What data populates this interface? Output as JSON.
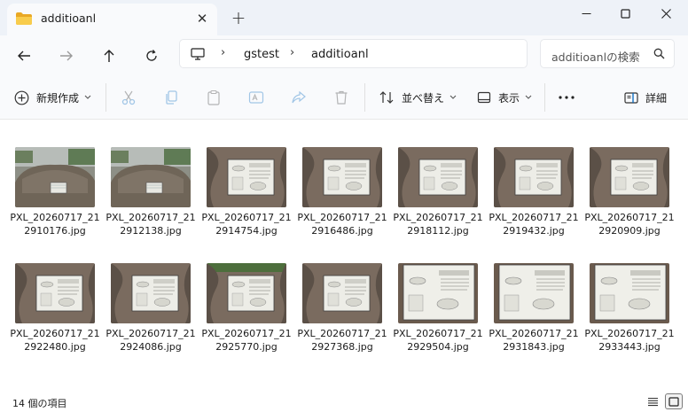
{
  "tab": {
    "title": "additioanl"
  },
  "address": {
    "crumbs": [
      "gstest",
      "additioanl"
    ]
  },
  "search": {
    "placeholder": "additioanlの検索"
  },
  "toolbar": {
    "new_label": "新規作成",
    "sort_label": "並べ替え",
    "view_label": "表示",
    "details_label": "詳細"
  },
  "files": [
    {
      "name": "PXL_20260717_212910176.jpg",
      "kind": "wide"
    },
    {
      "name": "PXL_20260717_212912138.jpg",
      "kind": "wide"
    },
    {
      "name": "PXL_20260717_212914754.jpg",
      "kind": "plaque"
    },
    {
      "name": "PXL_20260717_212916486.jpg",
      "kind": "plaque"
    },
    {
      "name": "PXL_20260717_212918112.jpg",
      "kind": "plaque"
    },
    {
      "name": "PXL_20260717_212919432.jpg",
      "kind": "plaque"
    },
    {
      "name": "PXL_20260717_212920909.jpg",
      "kind": "plaque"
    },
    {
      "name": "PXL_20260717_212922480.jpg",
      "kind": "plaque"
    },
    {
      "name": "PXL_20260717_212924086.jpg",
      "kind": "plaque"
    },
    {
      "name": "PXL_20260717_212925770.jpg",
      "kind": "tree"
    },
    {
      "name": "PXL_20260717_212927368.jpg",
      "kind": "plaque"
    },
    {
      "name": "PXL_20260717_212929504.jpg",
      "kind": "close"
    },
    {
      "name": "PXL_20260717_212931843.jpg",
      "kind": "close"
    },
    {
      "name": "PXL_20260717_212933443.jpg",
      "kind": "close"
    }
  ],
  "status": {
    "count": "14 個の項目"
  },
  "colors": {
    "accent": "#0067c0",
    "folder": "#f4c343",
    "titlebar": "#eef2f8"
  }
}
